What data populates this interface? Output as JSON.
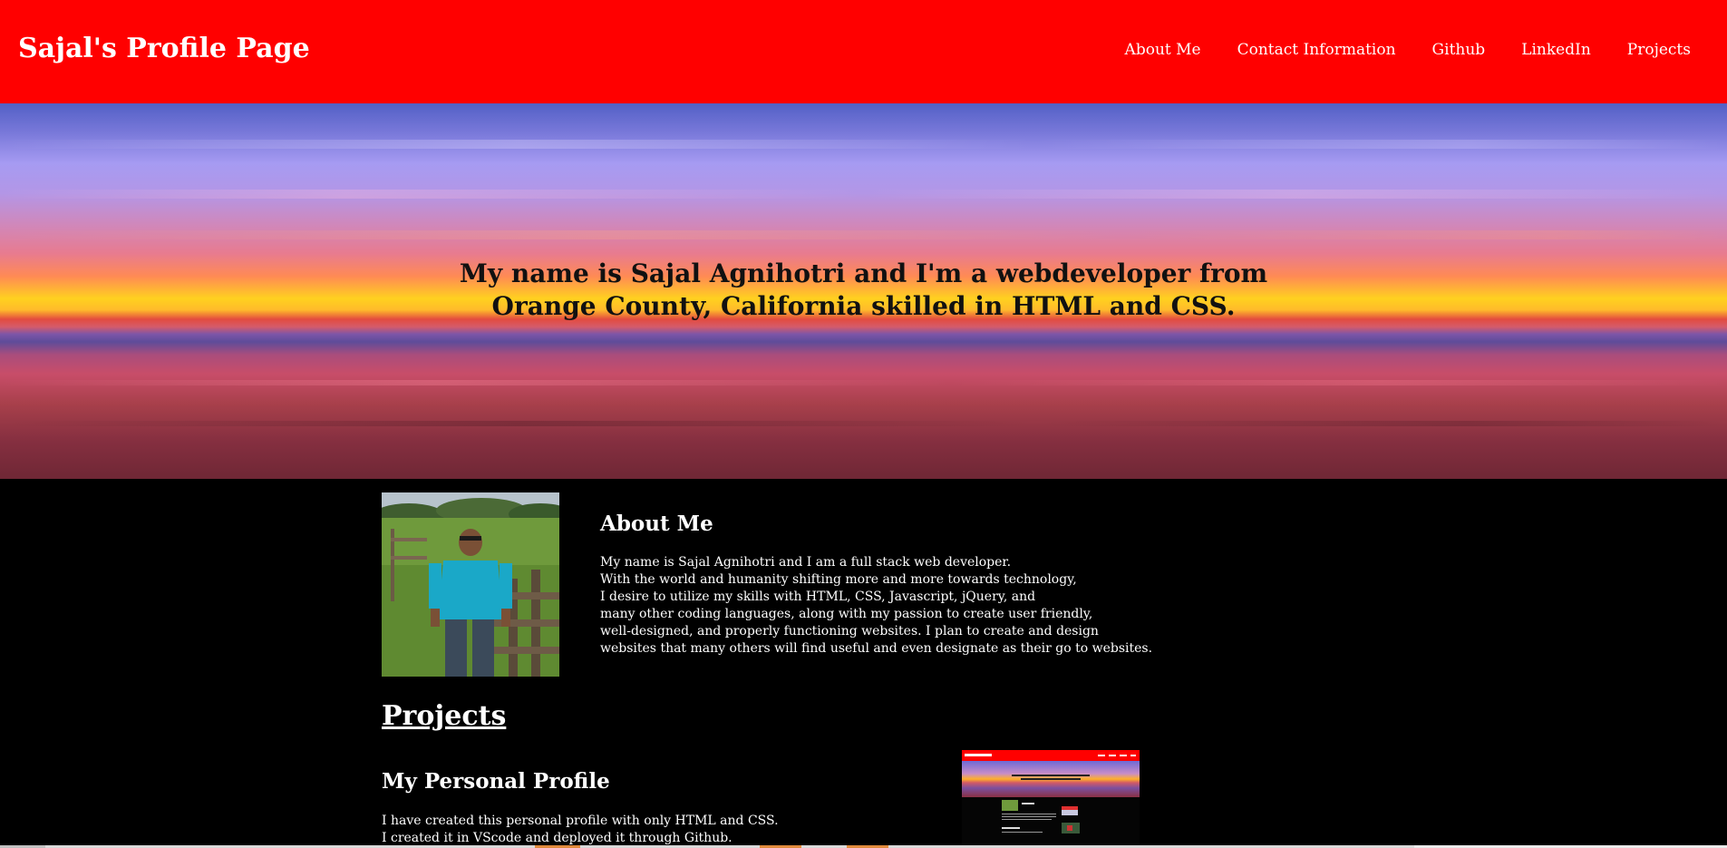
{
  "header": {
    "title": "Sajal's Profile Page",
    "background_color": "#ff0000",
    "nav": [
      "About Me",
      "Contact Information",
      "Github",
      "LinkedIn",
      "Projects"
    ]
  },
  "hero": {
    "headline": "My name is Sajal Agnihotri and I'm a webdeveloper from Orange County, California skilled in HTML and CSS."
  },
  "about": {
    "title": "About Me",
    "lines": [
      "My name is Sajal Agnihotri and I am a full stack web developer.",
      "With the world and humanity shifting more and more towards technology,",
      "I desire to utilize my skills with HTML, CSS, Javascript, jQuery, and",
      "many other coding languages, along with my passion to create user friendly,",
      "well-designed, and properly functioning websites. I plan to create and design",
      "websites that many others will find useful and even designate as their go to websites."
    ]
  },
  "projects": {
    "title": "Projects",
    "items": [
      {
        "title": "My Personal Profile",
        "lines": [
          "I have created this personal profile with only HTML and CSS.",
          "I created it in VScode and deployed it through Github."
        ]
      }
    ]
  }
}
